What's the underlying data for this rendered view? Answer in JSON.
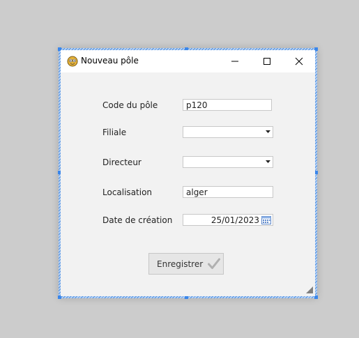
{
  "window": {
    "title": "Nouveau pôle",
    "icons": {
      "app": "app-icon",
      "minimize": "minimize-icon",
      "maximize": "maximize-icon",
      "close": "close-icon"
    }
  },
  "form": {
    "code_label": "Code du pôle",
    "code_value": "p120",
    "filiale_label": "Filiale",
    "filiale_value": "",
    "directeur_label": "Directeur",
    "directeur_value": "",
    "localisation_label": "Localisation",
    "localisation_value": "alger",
    "date_label": "Date de création",
    "date_value": "25/01/2023",
    "save_label": "Enregistrer"
  },
  "colors": {
    "selection_border": "#3a86ea",
    "window_bg": "#f2f2f2",
    "titlebar_bg": "#ffffff"
  }
}
